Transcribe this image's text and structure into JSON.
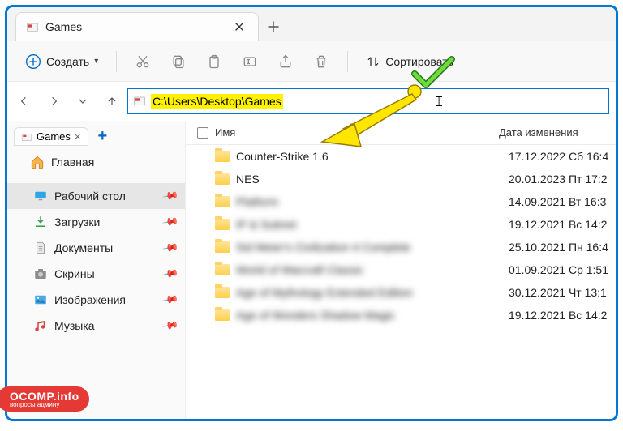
{
  "tab": {
    "title": "Games"
  },
  "toolbar": {
    "create_label": "Создать",
    "sort_label": "Сортировать"
  },
  "address": {
    "path": "C:\\Users\\Desktop\\Games"
  },
  "sidebar": {
    "tab_label": "Games",
    "home_label": "Главная",
    "items": [
      {
        "label": "Рабочий стол",
        "selected": true,
        "icon": "desktop"
      },
      {
        "label": "Загрузки",
        "selected": false,
        "icon": "downloads"
      },
      {
        "label": "Документы",
        "selected": false,
        "icon": "documents"
      },
      {
        "label": "Скрины",
        "selected": false,
        "icon": "camera"
      },
      {
        "label": "Изображения",
        "selected": false,
        "icon": "pictures"
      },
      {
        "label": "Музыка",
        "selected": false,
        "icon": "music"
      }
    ]
  },
  "columns": {
    "name": "Имя",
    "date": "Дата изменения"
  },
  "files": [
    {
      "name": "Counter-Strike 1.6",
      "date": "17.12.2022 Сб 16:4",
      "blur": false
    },
    {
      "name": "NES",
      "date": "20.01.2023 Пт 17:2",
      "blur": false
    },
    {
      "name": "Platform",
      "date": "14.09.2021 Вт 16:3",
      "blur": true
    },
    {
      "name": "IP & Subnet",
      "date": "19.12.2021 Вс 14:2",
      "blur": true
    },
    {
      "name": "Sid Meier's Civilization 4 Complete",
      "date": "25.10.2021 Пн 16:4",
      "blur": true
    },
    {
      "name": "World of Warcraft Classic",
      "date": "01.09.2021 Ср 1:51",
      "blur": true
    },
    {
      "name": "Age of Mythology Extended Edition",
      "date": "30.12.2021 Чт 13:1",
      "blur": true
    },
    {
      "name": "Age of Wonders Shadow Magic",
      "date": "19.12.2021 Вс 14:2",
      "blur": true
    }
  ],
  "watermark": {
    "main": "OCOMP.info",
    "sub": "вопросы админу"
  }
}
